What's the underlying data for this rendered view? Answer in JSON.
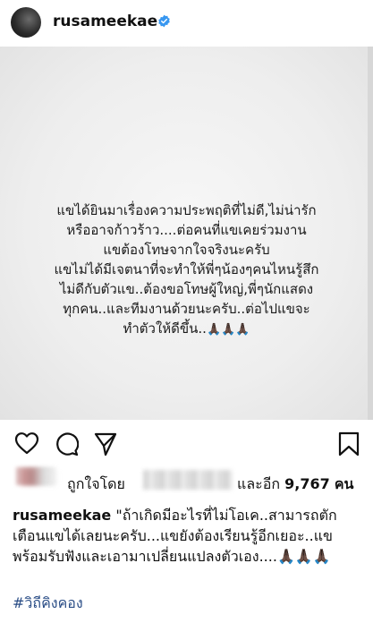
{
  "post": {
    "username": "rusameekae",
    "image_text": {
      "lines": [
        "แขได้ยินมาเรื่องความประพฤติที่ไม่ดี,ไม่น่ารัก",
        "หรืออาจก้าวร้าว....ต่อคนที่แขเคยร่วมงาน",
        "แขต้องโทษจากใจจริงนะครับ",
        "แขไม่ได้มีเจตนาที่จะทำให้พี่ๆน้องๆคนไหนรู้สึก",
        "ไม่ดีกับตัวแข..ต้องขอโทษผู้ใหญ่,พี่ๆนักแสดง",
        "ทุกคน..และทีมงานด้วยนะครับ..ต่อไปแขจะ",
        "ทำตัวให้ดีขึ้น.."
      ],
      "emoji": "🙏🏿🙏🏿🙏🏿"
    }
  },
  "likes": {
    "prefix": "ถูกใจโดย",
    "and_more": "และอีก",
    "count": "9,767",
    "suffix": "คน"
  },
  "caption": {
    "username": "rusameekae",
    "text": "\"ถ้าเกิดมีอะไรที่ไม่โอเค..สามารถตักเตือนแขได้เลยนะครับ...แขยังต้องเรียนรู้อีกเยอะ..แขพร้อมรับฟังและเอามาเปลี่ยนแปลงตัวเอง....",
    "emoji": "🙏🏿🙏🏿🙏🏿",
    "hashtag": "#วิถีคิงคอง"
  },
  "icons": {
    "verified": "verified-badge-icon",
    "like": "heart-icon",
    "comment": "comment-icon",
    "share": "send-icon",
    "save": "bookmark-icon"
  },
  "colors": {
    "verified": "#3897f0",
    "hashtag": "#2a4d86"
  }
}
